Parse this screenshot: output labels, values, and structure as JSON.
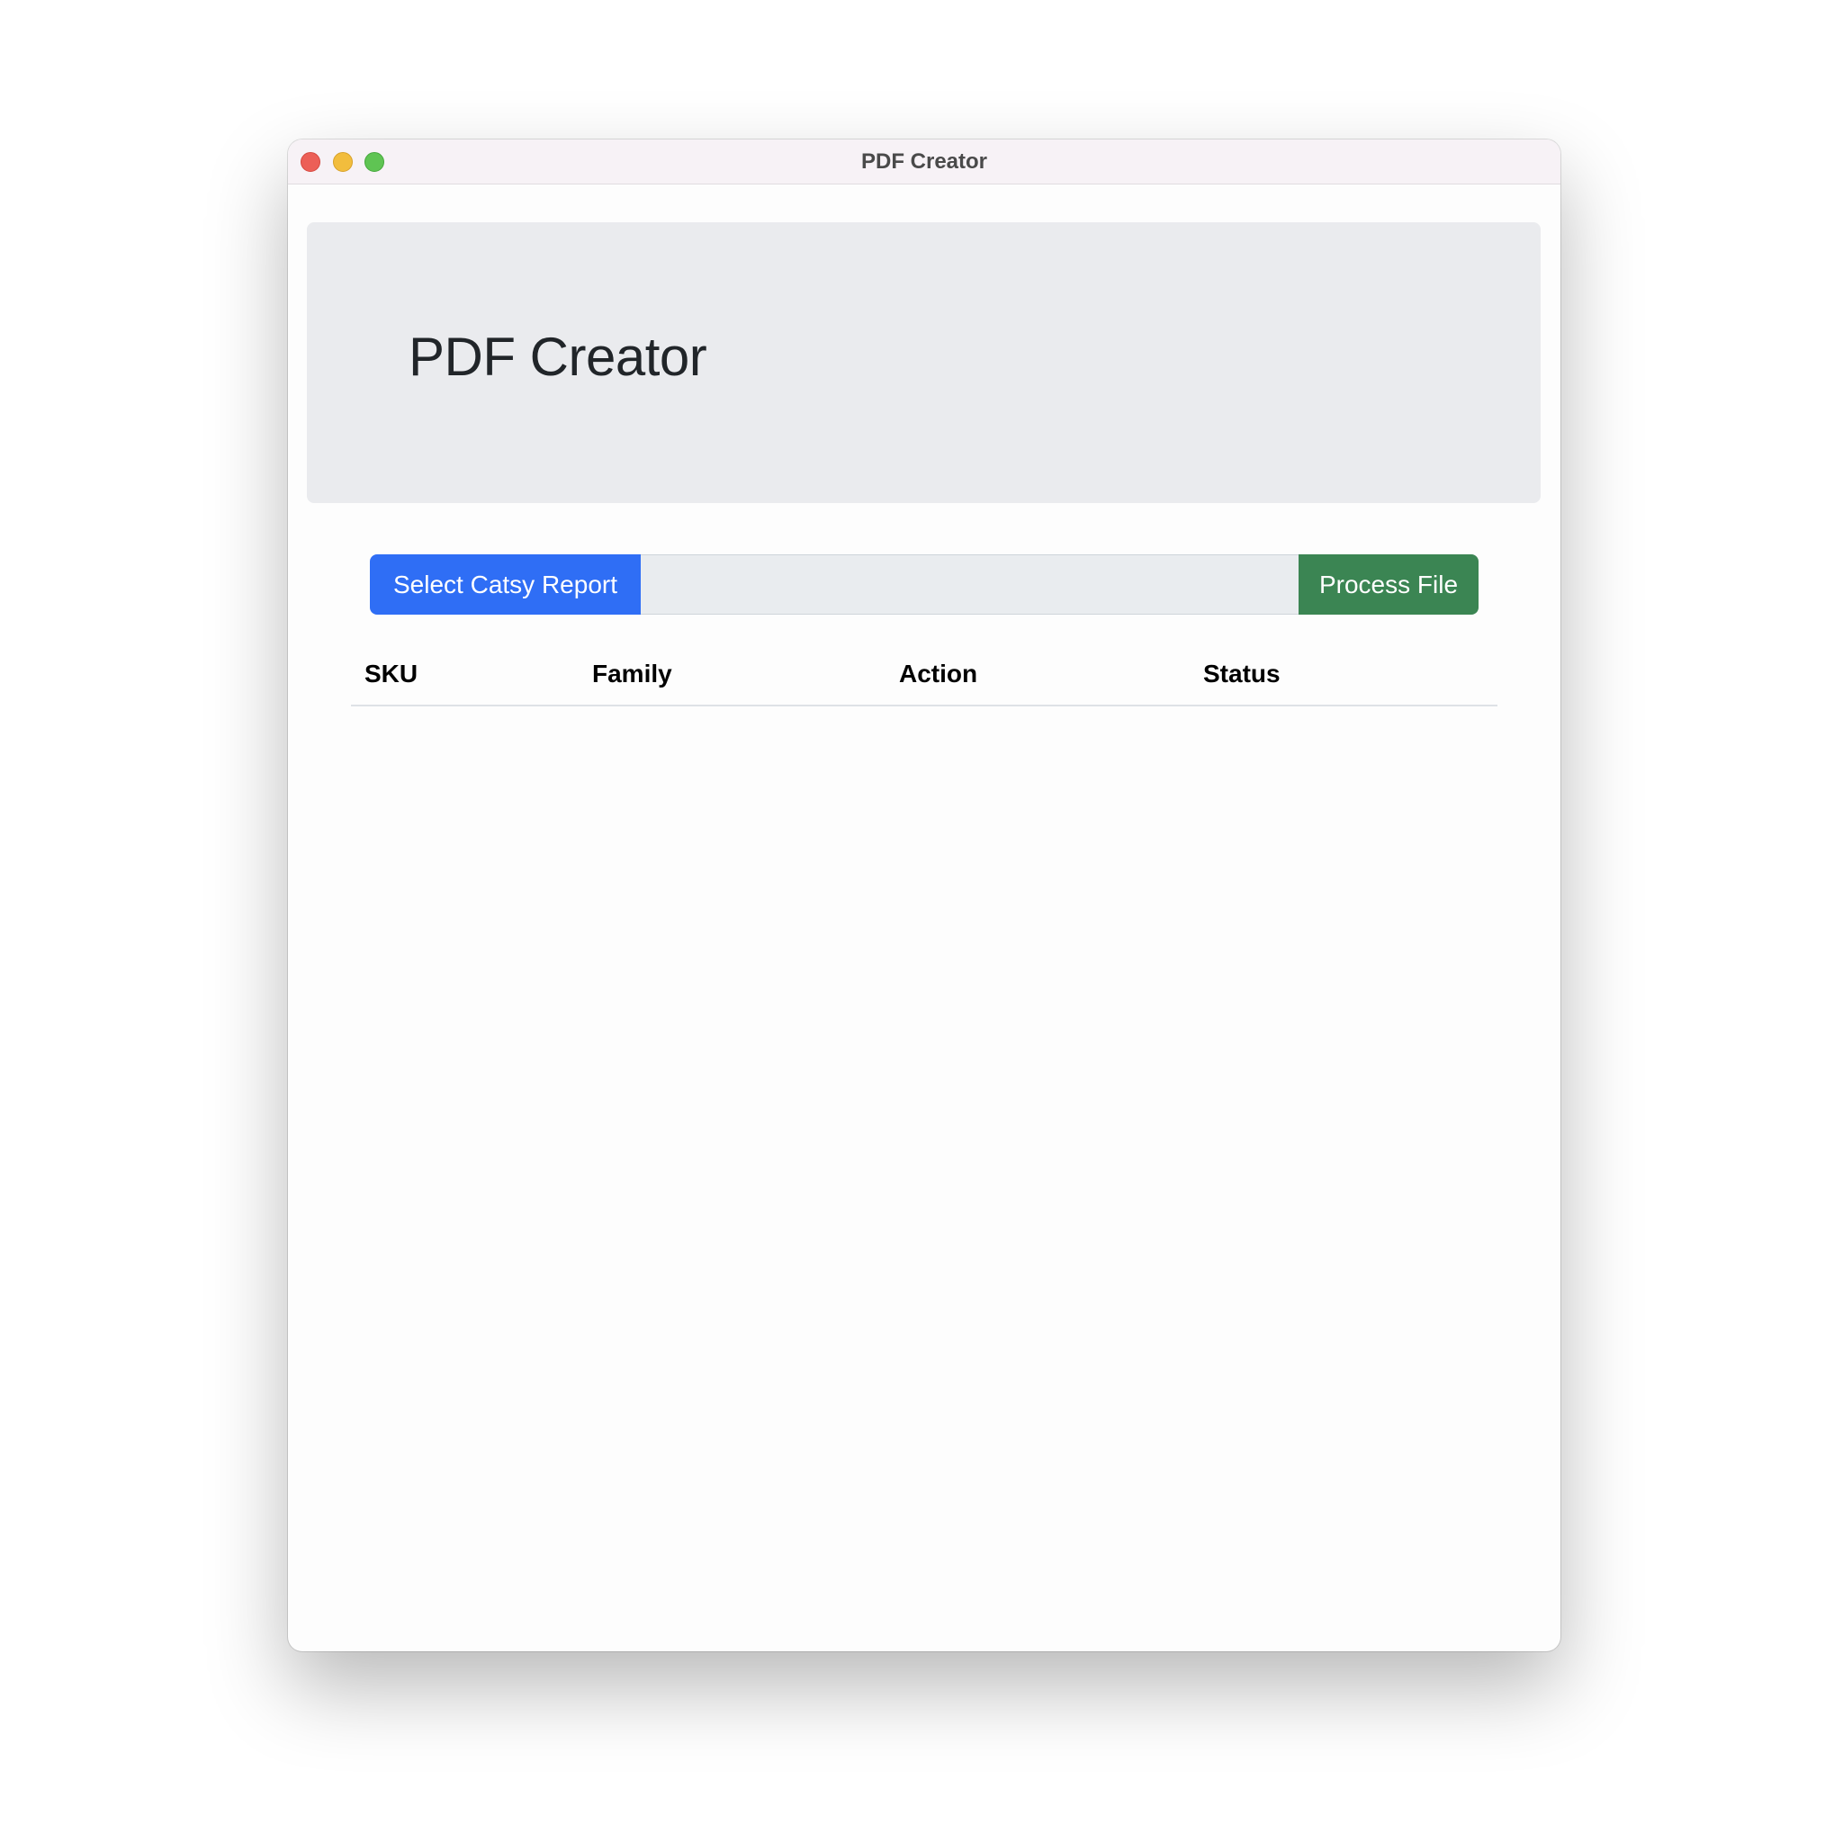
{
  "window": {
    "title": "PDF Creator",
    "controls": [
      "close",
      "minimize",
      "zoom"
    ]
  },
  "hero": {
    "title": "PDF Creator"
  },
  "file_picker": {
    "select_label": "Select Catsy Report",
    "file_value": "",
    "process_label": "Process File"
  },
  "table": {
    "columns": [
      "SKU",
      "Family",
      "Action",
      "Status"
    ],
    "rows": []
  },
  "colors": {
    "primary": "#2f6ef5",
    "success": "#3b8553",
    "hero_bg": "#eaebee"
  }
}
